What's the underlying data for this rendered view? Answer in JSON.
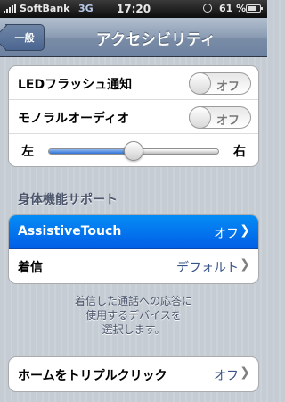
{
  "status_bar": {
    "carrier": "SoftBank",
    "network": "3G",
    "time": "17:20",
    "battery_percent": "61 %"
  },
  "nav": {
    "back_label": "一般",
    "title": "アクセシビリティ"
  },
  "group1": {
    "led_flash_label": "LEDフラッシュ通知",
    "led_flash_toggle": "オフ",
    "mono_audio_label": "モノラルオーディオ",
    "mono_audio_toggle": "オフ",
    "balance_left": "左",
    "balance_right": "右",
    "balance_value": 0.5
  },
  "section_header": "身体機能サポート",
  "group2": {
    "assistive_label": "AssistiveTouch",
    "assistive_value": "オフ",
    "incoming_label": "着信",
    "incoming_value": "デフォルト"
  },
  "footer_note": "着信した通話への応答に\n使用するデバイスを\n選択します。",
  "group3": {
    "triple_click_label": "ホームをトリプルクリック",
    "triple_click_value": "オフ"
  },
  "colors": {
    "selected_row": "#0a6ef0",
    "value_text": "#385487",
    "header_text": "#4c566c"
  },
  "icons": [
    "signal-bars-icon",
    "rotation-lock-icon",
    "battery-icon",
    "chevron-right-icon"
  ]
}
